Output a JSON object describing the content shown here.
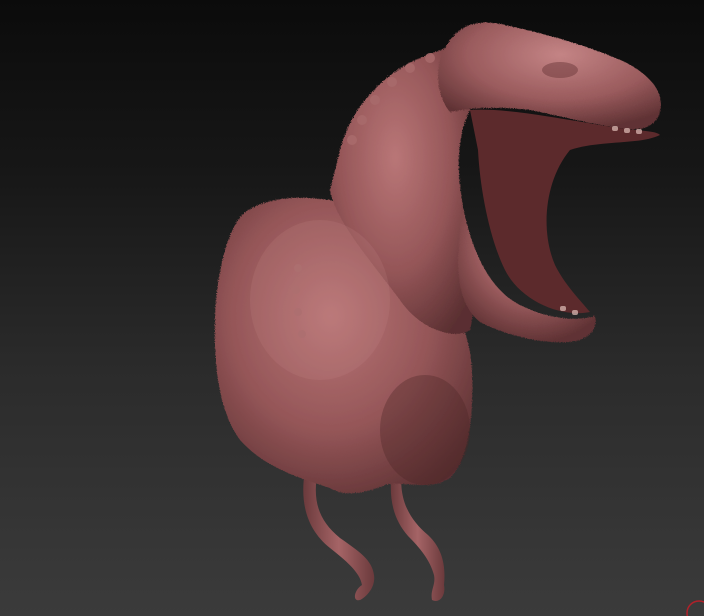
{
  "viewport": {
    "background_top": "#0b0b0b",
    "background_bottom": "#3b3b3b"
  },
  "model": {
    "icon": "t-rex-sculpt",
    "material_color": "#9a5a5c",
    "shadow_color": "#4a2526",
    "highlight_color": "#c98a8a",
    "mouth_color": "#5c2a2c"
  },
  "corner_widget": {
    "icon": "navigation-circle-icon",
    "color": "#b0212a"
  }
}
